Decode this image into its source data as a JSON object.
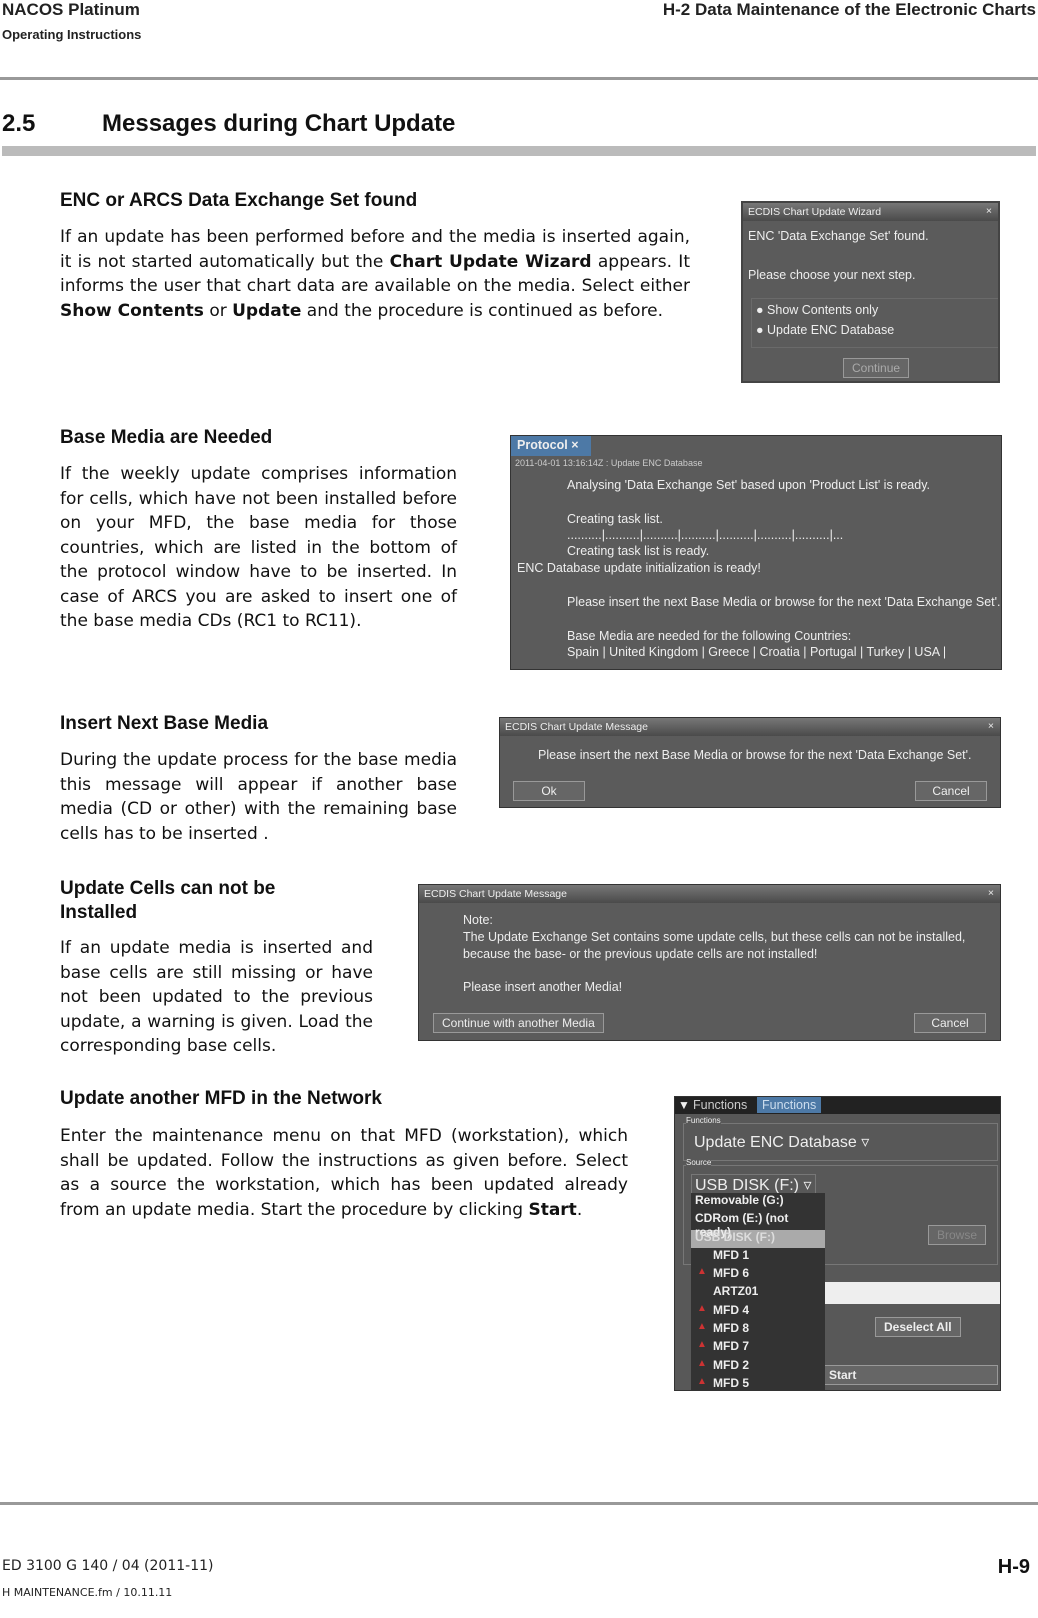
{
  "header": {
    "product": "NACOS Platinum",
    "doc_type": "Operating Instructions",
    "chapter": "H-2  Data Maintenance of the Electronic Charts"
  },
  "section": {
    "number": "2.5",
    "title": "Messages during Chart Update"
  },
  "blocks": [
    {
      "title": "ENC or ARCS Data Exchange Set found",
      "text_parts": [
        "If an update has been performed before and the media is inserted again, it is not started automatically but the ",
        "Chart Update Wizard",
        " appears. It informs the user that chart data are available on the media. Select either ",
        "Show Contents",
        " or ",
        "Update",
        " and the procedure is continued as before."
      ]
    },
    {
      "title": "Base Media are Needed",
      "text": "If the weekly update comprises information for cells, which have not been installed before on your MFD, the base media for those countries, which are listed in the bottom of the protocol window have to be inserted. In case of ARCS you are asked to insert one of the base media CDs (RC1 to RC11)."
    },
    {
      "title": "Insert Next Base Media",
      "text": "During the update process for the base media this message will appear if another base media (CD or other) with the remaining base cells has to be inserted ."
    },
    {
      "title": "Update Cells can not be Installed",
      "text": "If an update media is inserted and base cells are still missing or have not been updated to the previous update, a warning is given. Load the corresponding base cells."
    },
    {
      "title": "Update another MFD in the Network",
      "text_parts": [
        "Enter the maintenance menu on that MFD (workstation), which shall be updated. Follow the instructions as given before. Select as a source the workstation, which has been updated already from an update media. Start the procedure by clicking ",
        "Start",
        "."
      ]
    }
  ],
  "wizard": {
    "title": "ECDIS Chart Update Wizard",
    "close": "×",
    "line1": "ENC 'Data Exchange Set' found.",
    "line2": "Please choose your next step.",
    "options": [
      "Show Contents only",
      "Update ENC Database"
    ],
    "continue": "Continue"
  },
  "protocol": {
    "tab": "Protocol",
    "close": "×",
    "group": "2011-04-01 13:16:14Z : Update ENC Database",
    "lines": [
      "Analysing 'Data Exchange Set' based upon 'Product List' is ready.",
      "Creating task list.",
      "..........|..........|..........|..........|..........|..........|..........|...",
      "Creating task list is ready.",
      "ENC Database update initialization is ready!",
      "Please insert the next Base Media or browse for the next 'Data Exchange Set'.",
      "Base Media are needed for the following Countries:",
      "Spain | United Kingdom | Greece | Croatia | Portugal | Turkey | USA |"
    ]
  },
  "msg1": {
    "title": "ECDIS Chart Update Message",
    "close": "×",
    "text": "Please insert the next Base Media or browse for the next 'Data Exchange Set'.",
    "ok": "Ok",
    "cancel": "Cancel"
  },
  "msg2": {
    "title": "ECDIS Chart Update Message",
    "close": "×",
    "lines": [
      "Note:",
      "The Update Exchange Set contains some update cells, but these cells can not be installed,",
      "because the base- or the previous update cells are not installed!",
      "Please insert another Media!"
    ],
    "continue": "Continue with another Media",
    "cancel": "Cancel"
  },
  "functions": {
    "tabs": [
      "Functions",
      "Functions"
    ],
    "group_functions": "Functions",
    "function_value": "Update ENC Database",
    "group_source": "Source",
    "source_value": "USB DISK (F:)",
    "browse": "Browse",
    "deselect": "Deselect All",
    "start": "Start",
    "options": [
      {
        "label": "Removable (G:)",
        "warn": false
      },
      {
        "label": "CDRom (E:) (not ready)",
        "warn": false
      },
      {
        "label": "USB DISK (F:)",
        "warn": false,
        "selected": true
      },
      {
        "label": "MFD 1",
        "warn": false
      },
      {
        "label": "MFD 6",
        "warn": true
      },
      {
        "label": "ARTZ01",
        "warn": false
      },
      {
        "label": "MFD 4",
        "warn": true
      },
      {
        "label": "MFD 8",
        "warn": true
      },
      {
        "label": "MFD 7",
        "warn": true
      },
      {
        "label": "MFD 2",
        "warn": true
      },
      {
        "label": "MFD 5",
        "warn": true
      }
    ]
  },
  "footer": {
    "doc_id": "ED 3100 G 140 / 04 (2011-11)",
    "file": "H MAINTENANCE.fm / 10.11.11",
    "page": "H-9"
  }
}
